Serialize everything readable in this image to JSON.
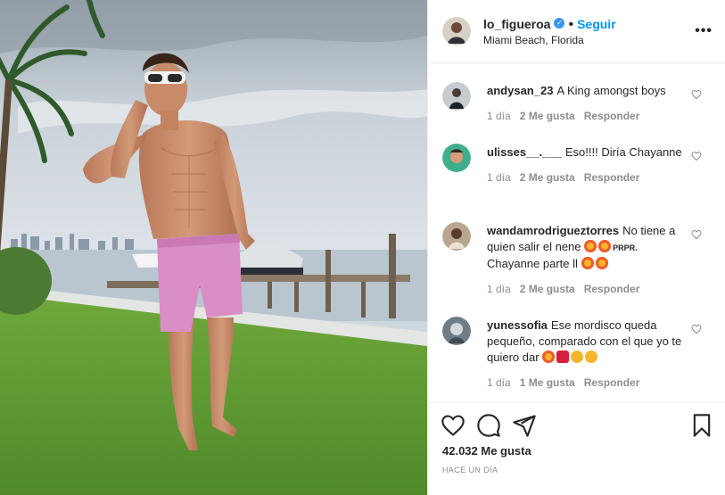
{
  "post": {
    "username": "lo_figueroa",
    "dot": "•",
    "follow_label": "Seguir",
    "location": "Miami Beach, Florida",
    "more_label": "•••",
    "likes": "42.032 Me gusta",
    "time_ago": "HACE UN DÍA"
  },
  "comments": [
    {
      "username": "andysan_23",
      "text": "A King amongst boys",
      "time": "1 día",
      "likes": "2 Me gusta",
      "reply": "Responder"
    },
    {
      "username": "ulisses__.___",
      "text": "Eso!!!! Diría Chayanne",
      "time": "1 día",
      "likes": "2 Me gusta",
      "reply": "Responder"
    },
    {
      "username": "wandamrodrigueztorres",
      "text": "No tiene a quien salir el nene",
      "text2": "PRPR.",
      "text3": "Chayanne parte ll",
      "time": "1 día",
      "likes": "2 Me gusta",
      "reply": "Responder"
    },
    {
      "username": "yunessofia",
      "text": "Ese mordisco queda pequeño, comparado con el que yo te quiero dar",
      "time": "1 día",
      "likes": "1 Me gusta",
      "reply": "Responder"
    }
  ],
  "colors": {
    "accent": "#0095f6",
    "verified": "#3897f0",
    "muted": "#8e8e8e",
    "emoji_star": "#f25a2b",
    "emoji_heart": "#d61f3a",
    "emoji_laugh": "#f7b529"
  },
  "icons": [
    "verified-badge-icon",
    "more-options-icon",
    "heart-icon",
    "comment-icon",
    "share-icon",
    "bookmark-icon"
  ]
}
